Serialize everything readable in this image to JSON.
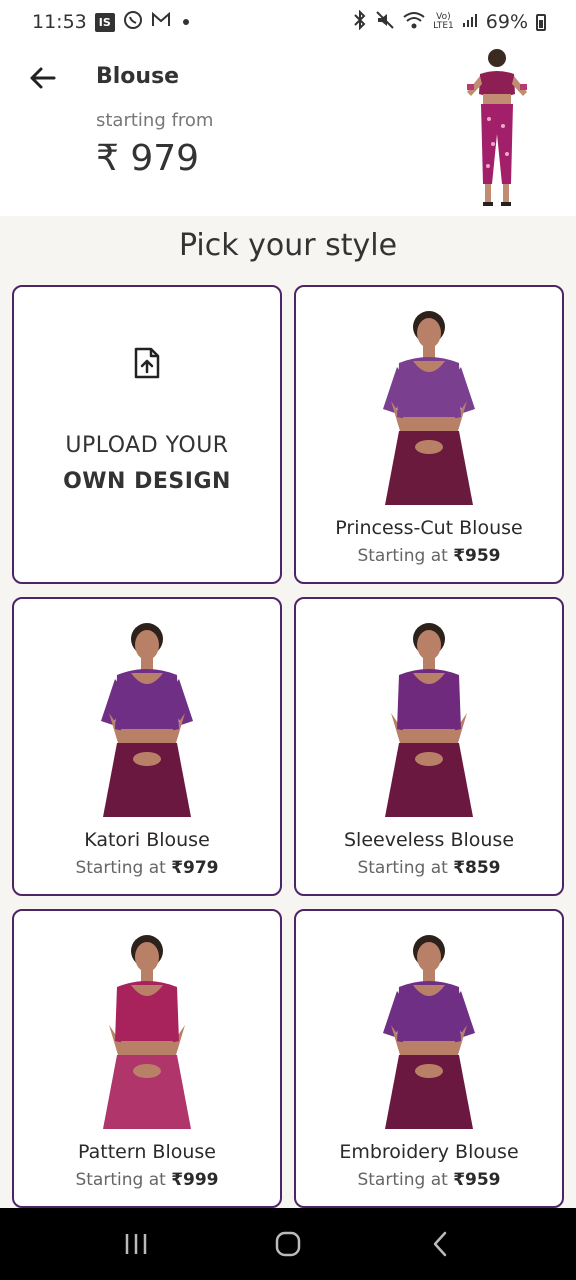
{
  "status": {
    "time": "11:53",
    "app_badge": "IS",
    "battery": "69%"
  },
  "header": {
    "title": "Blouse",
    "starting_label": "starting from",
    "price": "₹ 979"
  },
  "section_title": "Pick your style",
  "upload": {
    "line1": "UPLOAD YOUR",
    "line2": "OWN DESIGN"
  },
  "starting_at": "Starting at",
  "styles": [
    {
      "name": "Princess-Cut Blouse",
      "price": "₹959",
      "top_color": "#7a3f8f",
      "skirt_color": "#6a1b3d",
      "sleeve": "half"
    },
    {
      "name": "Katori Blouse",
      "price": "₹979",
      "top_color": "#6f2f85",
      "skirt_color": "#6b1840",
      "sleeve": "half"
    },
    {
      "name": "Sleeveless Blouse",
      "price": "₹859",
      "top_color": "#6f2a7e",
      "skirt_color": "#6b1840",
      "sleeve": "none"
    },
    {
      "name": "Pattern Blouse",
      "price": "₹999",
      "top_color": "#a8235c",
      "skirt_color": "#b0356a",
      "sleeve": "none"
    },
    {
      "name": "Embroidery Blouse",
      "price": "₹959",
      "top_color": "#6f2f85",
      "skirt_color": "#6b1840",
      "sleeve": "half"
    }
  ],
  "colors": {
    "card_border": "#4b2566",
    "background": "#f7f5f1"
  }
}
